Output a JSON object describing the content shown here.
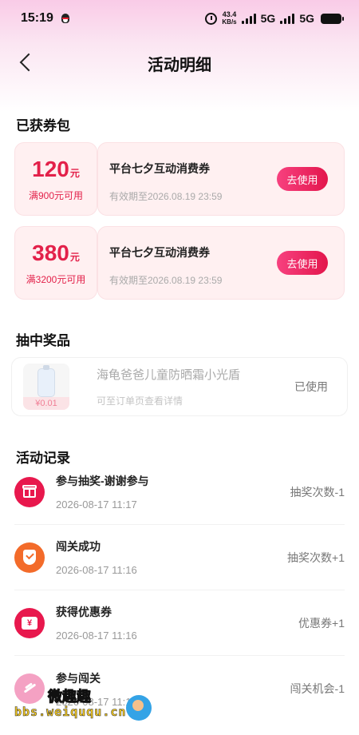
{
  "status_bar": {
    "time": "15:19",
    "net_speed_value": "43.4",
    "net_speed_unit": "KB/s",
    "network_1": "5G",
    "network_2": "5G"
  },
  "nav": {
    "title": "活动明细"
  },
  "coupon_section": {
    "title": "已获券包",
    "coupons": [
      {
        "amount": "120",
        "unit": "元",
        "condition": "满900元可用",
        "name": "平台七夕互动消费券",
        "expiry": "有效期至2026.08.19 23:59",
        "button": "去使用"
      },
      {
        "amount": "380",
        "unit": "元",
        "condition": "满3200元可用",
        "name": "平台七夕互动消费券",
        "expiry": "有效期至2026.08.19 23:59",
        "button": "去使用"
      }
    ]
  },
  "prize_section": {
    "title": "抽中奖品",
    "prize": {
      "name": "海龟爸爸儿童防晒霜小光盾",
      "sub": "可至订单页查看详情",
      "price": "¥0.01",
      "status": "已使用"
    }
  },
  "record_section": {
    "title": "活动记录",
    "records": [
      {
        "title": "参与抽奖-谢谢参与",
        "date": "2026-08-17 11:17",
        "value": "抽奖次数-1",
        "icon": "gift-icon"
      },
      {
        "title": "闯关成功",
        "date": "2026-08-17 11:16",
        "value": "抽奖次数+1",
        "icon": "shield-check-icon"
      },
      {
        "title": "获得优惠券",
        "date": "2026-08-17 11:16",
        "value": "优惠券+1",
        "icon": "coupon-icon"
      },
      {
        "title": "参与闯关",
        "date": "2026-08-17 11:16",
        "value": "闯关机会-1",
        "icon": "paper-plane-icon"
      }
    ]
  },
  "watermark": {
    "top": "微趣趣",
    "bottom": "bbs.weiququ.cn"
  },
  "colors": {
    "accent": "#e3214a",
    "coupon_bg": "#fff0f1",
    "gradient_top": "#f9cbe7"
  }
}
